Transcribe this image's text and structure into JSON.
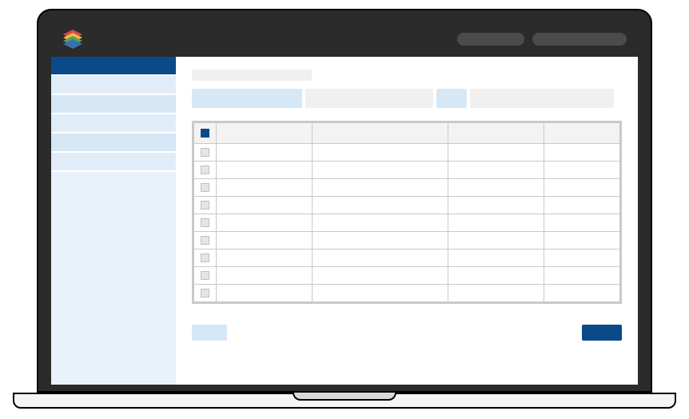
{
  "topbar": {
    "logo_name": "app-logo",
    "pills": [
      {
        "name": "topbar-button-1",
        "label": ""
      },
      {
        "name": "topbar-button-2",
        "label": ""
      }
    ]
  },
  "sidebar": {
    "items": [
      {
        "name": "sidebar-item-0",
        "label": "",
        "active": true
      },
      {
        "name": "sidebar-item-1",
        "label": "",
        "active": false
      },
      {
        "name": "sidebar-item-2",
        "label": "",
        "active": false
      },
      {
        "name": "sidebar-item-3",
        "label": "",
        "active": false
      },
      {
        "name": "sidebar-item-4",
        "label": "",
        "active": false
      },
      {
        "name": "sidebar-item-5",
        "label": "",
        "active": false
      }
    ]
  },
  "main": {
    "title": "",
    "tabs": [
      {
        "name": "tab-0",
        "label": "",
        "active": true
      },
      {
        "name": "tab-1",
        "label": "",
        "active": false
      },
      {
        "name": "tab-2",
        "label": "",
        "active": false
      },
      {
        "name": "tab-3",
        "label": "",
        "active": false
      }
    ],
    "table": {
      "select_all": true,
      "columns": [
        "",
        "",
        "",
        ""
      ],
      "rows": [
        {
          "selected": false,
          "cells": [
            "",
            "",
            "",
            ""
          ]
        },
        {
          "selected": false,
          "cells": [
            "",
            "",
            "",
            ""
          ]
        },
        {
          "selected": false,
          "cells": [
            "",
            "",
            "",
            ""
          ]
        },
        {
          "selected": false,
          "cells": [
            "",
            "",
            "",
            ""
          ]
        },
        {
          "selected": false,
          "cells": [
            "",
            "",
            "",
            ""
          ]
        },
        {
          "selected": false,
          "cells": [
            "",
            "",
            "",
            ""
          ]
        },
        {
          "selected": false,
          "cells": [
            "",
            "",
            "",
            ""
          ]
        },
        {
          "selected": false,
          "cells": [
            "",
            "",
            "",
            ""
          ]
        },
        {
          "selected": false,
          "cells": [
            "",
            "",
            "",
            ""
          ]
        }
      ]
    },
    "footer": {
      "secondary_label": "",
      "primary_label": ""
    }
  },
  "colors": {
    "brand_primary": "#0a4a8a",
    "sidebar_bg": "#e9f2fb",
    "tab_active": "#d6e7f6"
  }
}
